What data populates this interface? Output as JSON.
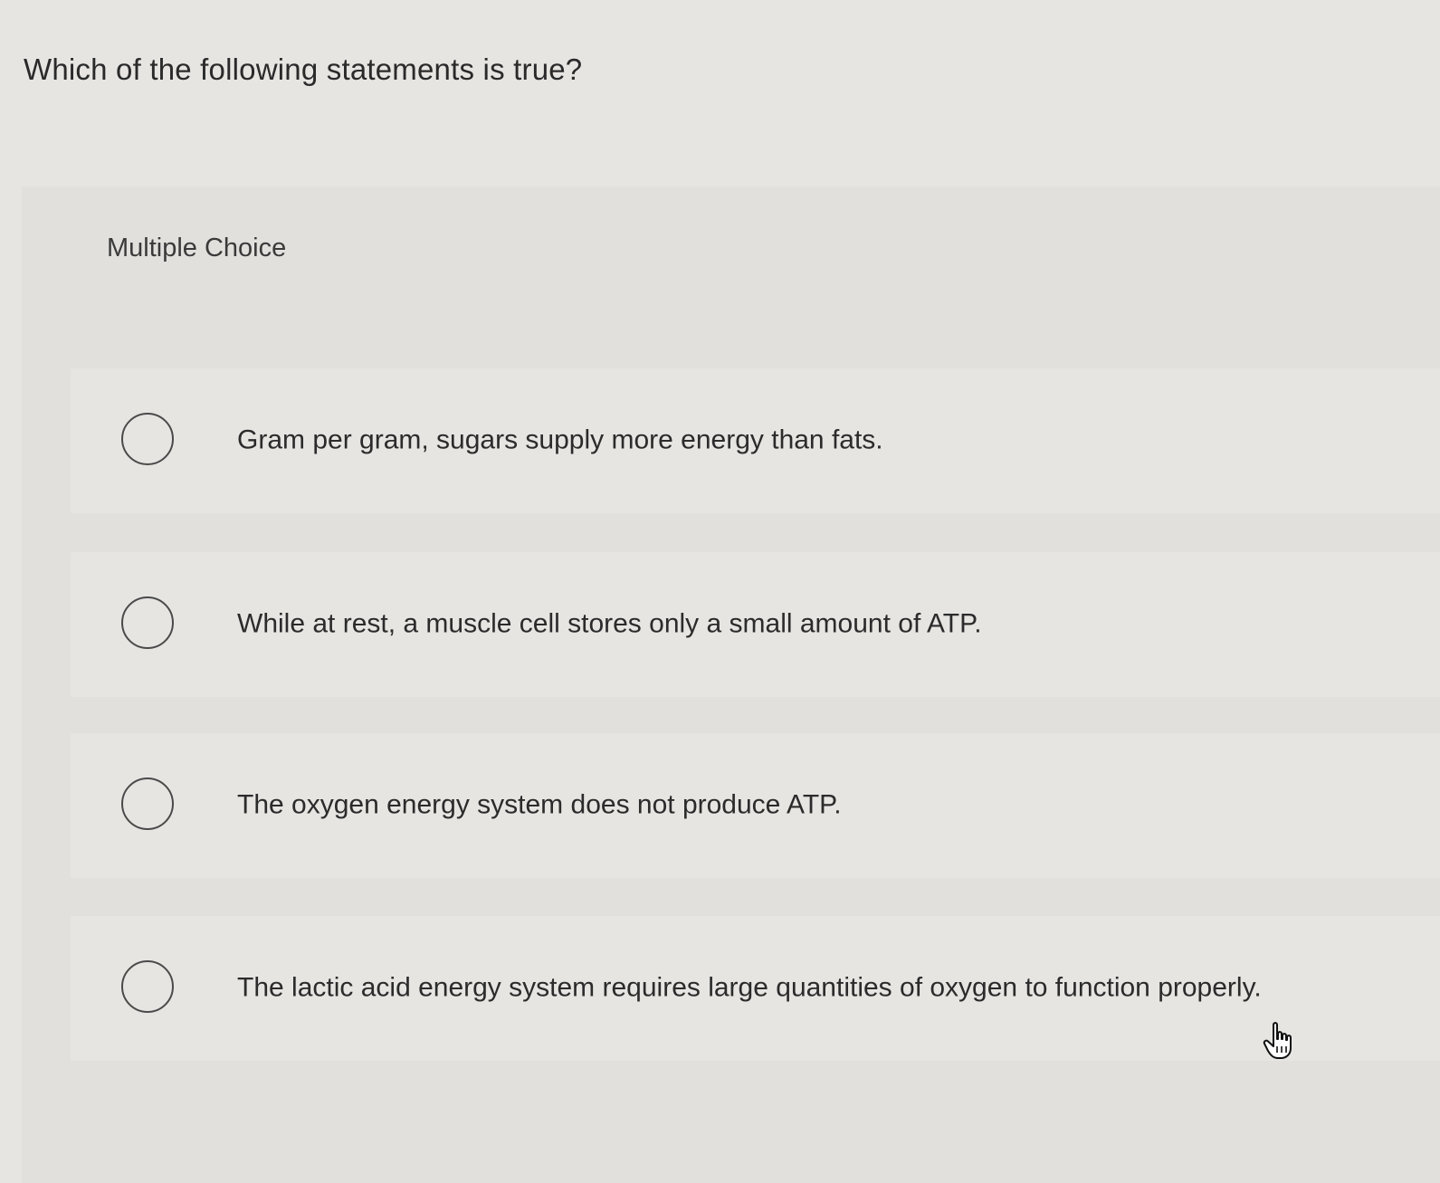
{
  "question": {
    "text": "Which of the following statements is true?"
  },
  "question_type": "Multiple Choice",
  "options": [
    {
      "label": "Gram per gram, sugars supply more energy than fats.",
      "selected": false
    },
    {
      "label": "While at rest, a muscle cell stores only a small amount of ATP.",
      "selected": false
    },
    {
      "label": "The oxygen energy system does not produce ATP.",
      "selected": false
    },
    {
      "label": "The lactic acid energy system requires large quantities of oxygen to function properly.",
      "selected": false
    }
  ],
  "icons": {
    "radio": "radio-circle-icon",
    "cursor": "hand-pointer-icon"
  },
  "colors": {
    "background": "#e6e5e2",
    "panel": "#e1e0dd",
    "text": "#2b2b2b",
    "radio_border": "#4a4a4a"
  }
}
